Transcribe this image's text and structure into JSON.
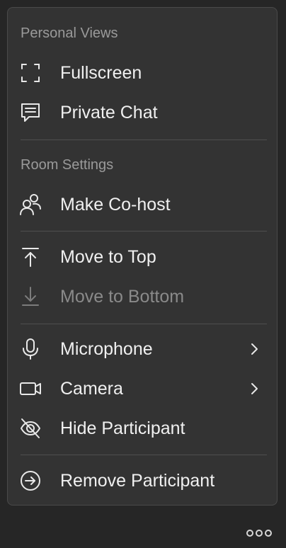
{
  "menu": {
    "personal_views_header": "Personal Views",
    "room_settings_header": "Room Settings",
    "items": {
      "fullscreen": {
        "label": "Fullscreen",
        "icon": "fullscreen-icon"
      },
      "private_chat": {
        "label": "Private Chat",
        "icon": "chat-icon"
      },
      "make_cohost": {
        "label": "Make Co-host",
        "icon": "cohost-icon"
      },
      "move_to_top": {
        "label": "Move to Top",
        "icon": "arrow-up-to-line-icon"
      },
      "move_to_bottom": {
        "label": "Move to Bottom",
        "icon": "arrow-down-to-line-icon",
        "disabled": true
      },
      "microphone": {
        "label": "Microphone",
        "icon": "microphone-icon",
        "has_submenu": true
      },
      "camera": {
        "label": "Camera",
        "icon": "camera-icon",
        "has_submenu": true
      },
      "hide_participant": {
        "label": "Hide Participant",
        "icon": "eye-off-icon"
      },
      "remove_participant": {
        "label": "Remove Participant",
        "icon": "remove-icon"
      }
    }
  },
  "more_button": {
    "icon": "more-horizontal-icon"
  },
  "colors": {
    "background": "#262626",
    "menu_background": "#333333",
    "text": "#f0f0f0",
    "header_text": "#9a9a9a",
    "disabled_text": "#8a8a8a"
  }
}
